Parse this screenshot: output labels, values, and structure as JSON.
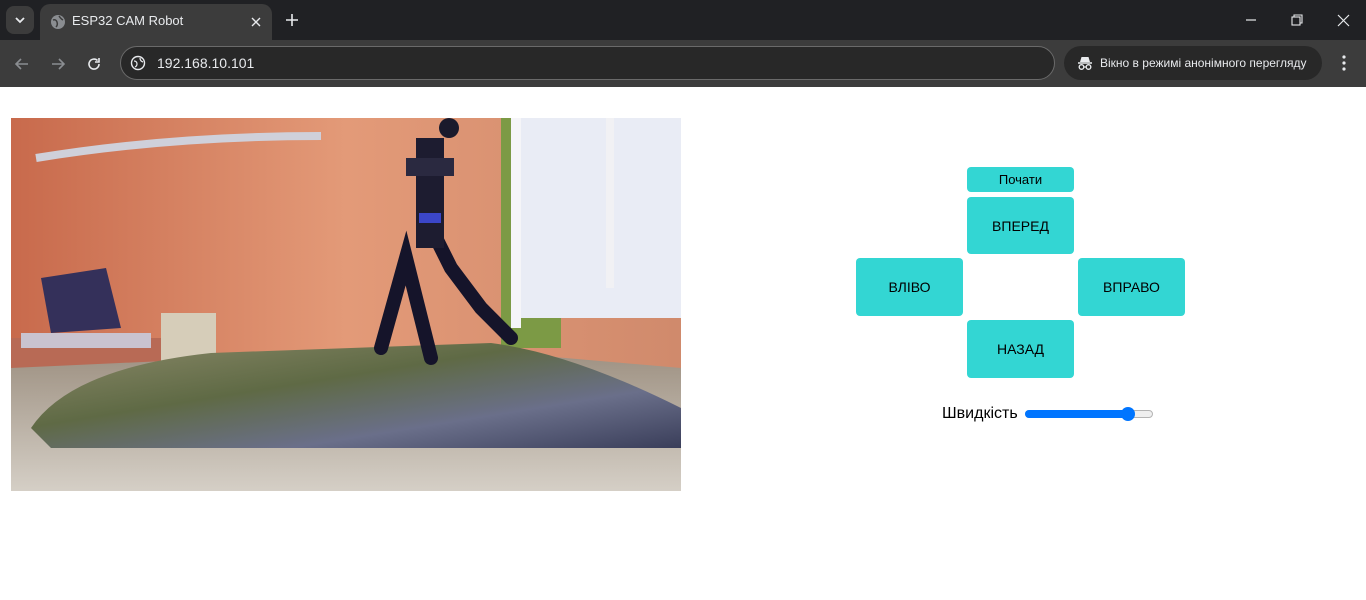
{
  "browser": {
    "tab_title": "ESP32 CAM Robot",
    "url": "192.168.10.101",
    "incognito_label": "Вікно в режимі анонімного перегляду",
    "icons": [
      "tab-list-icon",
      "globe-icon",
      "close-icon",
      "plus-icon",
      "minimize-icon",
      "restore-icon",
      "window-close-icon",
      "back-icon",
      "forward-icon",
      "reload-icon",
      "site-info-icon",
      "incognito-icon",
      "kebab-menu-icon"
    ]
  },
  "controls": {
    "start_label": "Почати",
    "forward_label": "ВПЕРЕД",
    "left_label": "ВЛІВО",
    "right_label": "ВПРАВО",
    "back_label": "НАЗАД",
    "speed_label": "Швидкість",
    "speed_value_fraction": 0.84,
    "button_color": "#33d6d3",
    "slider_color": "#0075ff"
  }
}
